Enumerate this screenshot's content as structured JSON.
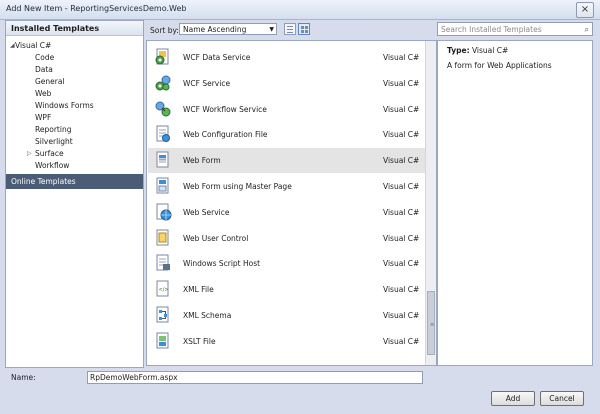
{
  "window": {
    "title": "Add New Item - ReportingServicesDemo.Web",
    "close_glyph": "×"
  },
  "left": {
    "header": "Installed Templates",
    "tree": [
      {
        "label": "Visual C#",
        "level": "top",
        "expander": "◢"
      },
      {
        "label": "Code",
        "level": "child",
        "expander": ""
      },
      {
        "label": "Data",
        "level": "child",
        "expander": ""
      },
      {
        "label": "General",
        "level": "child",
        "expander": ""
      },
      {
        "label": "Web",
        "level": "child",
        "expander": ""
      },
      {
        "label": "Windows Forms",
        "level": "child",
        "expander": ""
      },
      {
        "label": "WPF",
        "level": "child",
        "expander": ""
      },
      {
        "label": "Reporting",
        "level": "child",
        "expander": ""
      },
      {
        "label": "Silverlight",
        "level": "child",
        "expander": ""
      },
      {
        "label": "Surface",
        "level": "child",
        "expander": "▷"
      },
      {
        "label": "Workflow",
        "level": "child",
        "expander": ""
      }
    ],
    "online": "Online Templates"
  },
  "toolbar": {
    "sort_label": "Sort by:",
    "sort_value": "Name Ascending",
    "search_placeholder": "Search Installed Templates"
  },
  "templates": [
    {
      "name": "WCF Data Service",
      "lang": "Visual C#",
      "icon": "wcf-data-service-icon",
      "selected": false
    },
    {
      "name": "WCF Service",
      "lang": "Visual C#",
      "icon": "wcf-service-icon",
      "selected": false
    },
    {
      "name": "WCF Workflow Service",
      "lang": "Visual C#",
      "icon": "wcf-workflow-icon",
      "selected": false
    },
    {
      "name": "Web Configuration File",
      "lang": "Visual C#",
      "icon": "web-config-icon",
      "selected": false
    },
    {
      "name": "Web Form",
      "lang": "Visual C#",
      "icon": "web-form-icon",
      "selected": true
    },
    {
      "name": "Web Form using Master Page",
      "lang": "Visual C#",
      "icon": "web-form-master-icon",
      "selected": false
    },
    {
      "name": "Web Service",
      "lang": "Visual C#",
      "icon": "web-service-icon",
      "selected": false
    },
    {
      "name": "Web User Control",
      "lang": "Visual C#",
      "icon": "web-user-control-icon",
      "selected": false
    },
    {
      "name": "Windows Script Host",
      "lang": "Visual C#",
      "icon": "script-host-icon",
      "selected": false
    },
    {
      "name": "XML File",
      "lang": "Visual C#",
      "icon": "xml-file-icon",
      "selected": false
    },
    {
      "name": "XML Schema",
      "lang": "Visual C#",
      "icon": "xml-schema-icon",
      "selected": false
    },
    {
      "name": "XSLT File",
      "lang": "Visual C#",
      "icon": "xslt-file-icon",
      "selected": false
    }
  ],
  "details": {
    "type_label": "Type:",
    "type_value": "Visual C#",
    "description": "A form for Web Applications"
  },
  "footer": {
    "name_label": "Name:",
    "name_value": "RpDemoWebForm.aspx",
    "add_label": "Add",
    "cancel_label": "Cancel"
  },
  "colors": {
    "accent": "#4b5c77",
    "selected_row": "#e4e4e4",
    "background": "#d6dceb"
  }
}
